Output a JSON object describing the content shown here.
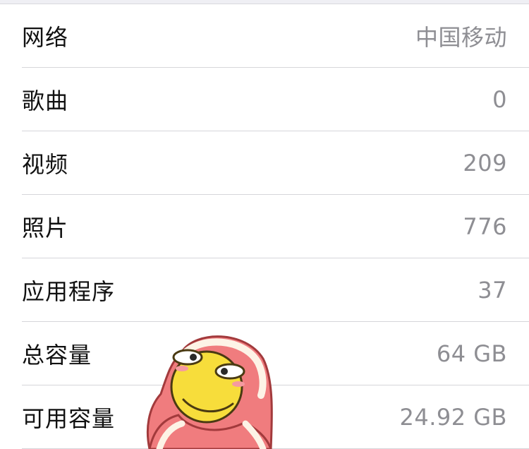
{
  "about": {
    "rows": [
      {
        "label": "网络",
        "value": "中国移动"
      },
      {
        "label": "歌曲",
        "value": "0"
      },
      {
        "label": "视频",
        "value": "209"
      },
      {
        "label": "照片",
        "value": "776"
      },
      {
        "label": "应用程序",
        "value": "37"
      },
      {
        "label": "总容量",
        "value": "64 GB"
      },
      {
        "label": "可用容量",
        "value": "24.92 GB"
      }
    ]
  },
  "sticker": {
    "icon": "blanket-smiley-emoji"
  },
  "colors": {
    "label": "#111111",
    "value": "#8e8e93",
    "separator": "#d6d6da",
    "smiley_yellow": "#f7dd3b",
    "blanket_red": "#f07c7e"
  }
}
